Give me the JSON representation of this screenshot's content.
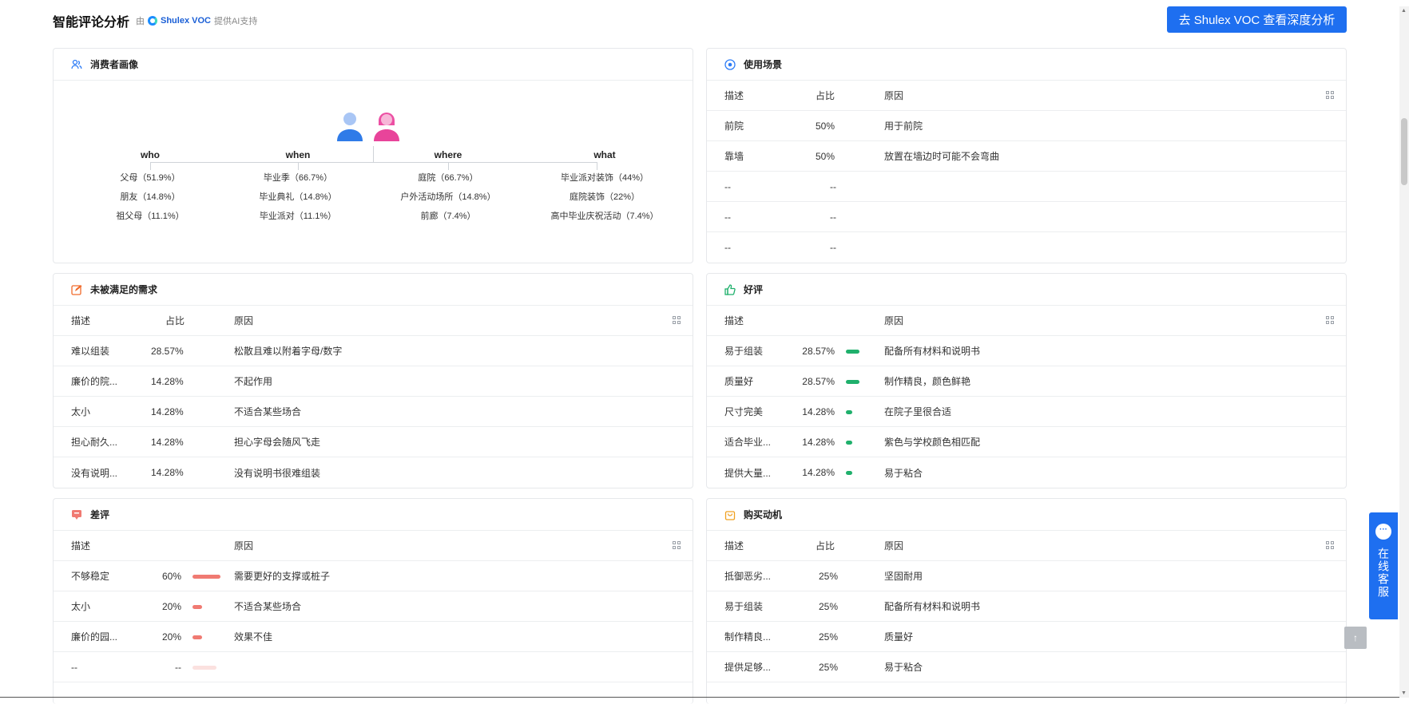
{
  "header": {
    "title": "智能评论分析",
    "by_prefix": "由",
    "brand": "Shulex VOC",
    "by_suffix": "提供AI支持",
    "deep_button": "去 Shulex VOC 查看深度分析"
  },
  "persona": {
    "title": "消费者画像",
    "columns": [
      {
        "label": "who",
        "items": [
          "父母（51.9%）",
          "朋友（14.8%）",
          "祖父母（11.1%）"
        ]
      },
      {
        "label": "when",
        "items": [
          "毕业季（66.7%）",
          "毕业典礼（14.8%）",
          "毕业派对（11.1%）"
        ]
      },
      {
        "label": "where",
        "items": [
          "庭院（66.7%）",
          "户外活动场所（14.8%）",
          "前廊（7.4%）"
        ]
      },
      {
        "label": "what",
        "items": [
          "毕业派对装饰（44%）",
          "庭院装饰（22%）",
          "高中毕业庆祝活动（7.4%）"
        ]
      }
    ]
  },
  "scenario": {
    "title": "使用场景",
    "headers": [
      "描述",
      "占比",
      "原因"
    ],
    "rows": [
      {
        "desc": "前院",
        "pct": "50%",
        "reason": "用于前院"
      },
      {
        "desc": "靠墙",
        "pct": "50%",
        "reason": "放置在墙边时可能不会弯曲"
      },
      {
        "desc": "--",
        "pct": "--",
        "reason": ""
      },
      {
        "desc": "--",
        "pct": "--",
        "reason": ""
      },
      {
        "desc": "--",
        "pct": "--",
        "reason": ""
      }
    ]
  },
  "unmet": {
    "title": "未被满足的需求",
    "headers": [
      "描述",
      "占比",
      "原因"
    ],
    "rows": [
      {
        "desc": "难以组装",
        "pct": "28.57%",
        "reason": "松散且难以附着字母/数字"
      },
      {
        "desc": "廉价的院...",
        "pct": "14.28%",
        "reason": "不起作用"
      },
      {
        "desc": "太小",
        "pct": "14.28%",
        "reason": "不适合某些场合"
      },
      {
        "desc": "担心耐久...",
        "pct": "14.28%",
        "reason": "担心字母会随风飞走"
      },
      {
        "desc": "没有说明...",
        "pct": "14.28%",
        "reason": "没有说明书很难组装"
      }
    ]
  },
  "positive": {
    "title": "好评",
    "headers": [
      "描述",
      "原因"
    ],
    "rows": [
      {
        "desc": "易于组装",
        "pct": "28.57%",
        "level": 0.2857,
        "reason": "配备所有材料和说明书"
      },
      {
        "desc": "质量好",
        "pct": "28.57%",
        "level": 0.2857,
        "reason": "制作精良，颜色鲜艳"
      },
      {
        "desc": "尺寸完美",
        "pct": "14.28%",
        "level": 0.1428,
        "reason": "在院子里很合适"
      },
      {
        "desc": "适合毕业...",
        "pct": "14.28%",
        "level": 0.1428,
        "reason": "紫色与学校颜色相匹配"
      },
      {
        "desc": "提供大量...",
        "pct": "14.28%",
        "level": 0.1428,
        "reason": "易于粘合"
      }
    ]
  },
  "negative": {
    "title": "差评",
    "headers": [
      "描述",
      "原因"
    ],
    "rows": [
      {
        "desc": "不够稳定",
        "pct": "60%",
        "level": 0.6,
        "reason": "需要更好的支撑或桩子"
      },
      {
        "desc": "太小",
        "pct": "20%",
        "level": 0.2,
        "reason": "不适合某些场合"
      },
      {
        "desc": "廉价的园...",
        "pct": "20%",
        "level": 0.2,
        "reason": "效果不佳"
      },
      {
        "desc": "--",
        "pct": "--",
        "level": 0,
        "reason": ""
      }
    ]
  },
  "motivation": {
    "title": "购买动机",
    "headers": [
      "描述",
      "占比",
      "原因"
    ],
    "rows": [
      {
        "desc": "抵御恶劣...",
        "pct": "25%",
        "reason": "坚固耐用"
      },
      {
        "desc": "易于组装",
        "pct": "25%",
        "reason": "配备所有材料和说明书"
      },
      {
        "desc": "制作精良...",
        "pct": "25%",
        "reason": "质量好"
      },
      {
        "desc": "提供足够...",
        "pct": "25%",
        "reason": "易于粘合"
      }
    ]
  },
  "service": {
    "label": "在线客服"
  },
  "colors": {
    "accent": "#1e6ff0",
    "positive_bar": "#1fb06c",
    "negative_bar": "#f07a72"
  }
}
